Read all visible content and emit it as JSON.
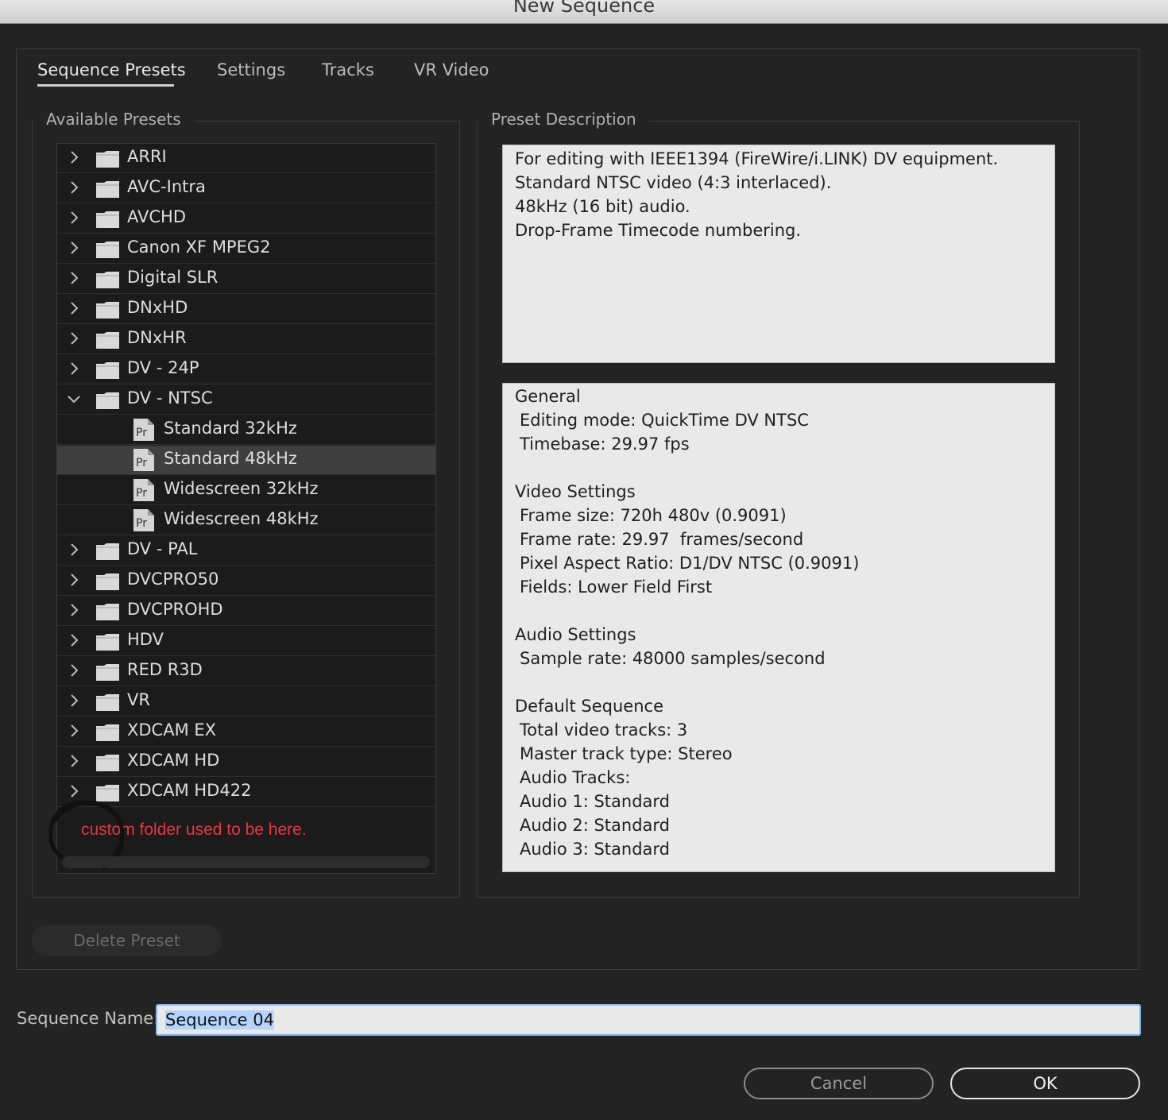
{
  "window": {
    "title": "New Sequence"
  },
  "tabs": [
    {
      "label": "Sequence Presets",
      "active": true
    },
    {
      "label": "Settings",
      "active": false
    },
    {
      "label": "Tracks",
      "active": false
    },
    {
      "label": "VR Video",
      "active": false
    }
  ],
  "presets": {
    "legend": "Available Presets",
    "items": [
      {
        "label": "ARRI",
        "type": "folder",
        "expanded": false
      },
      {
        "label": "AVC-Intra",
        "type": "folder",
        "expanded": false
      },
      {
        "label": "AVCHD",
        "type": "folder",
        "expanded": false
      },
      {
        "label": "Canon XF MPEG2",
        "type": "folder",
        "expanded": false
      },
      {
        "label": "Digital SLR",
        "type": "folder",
        "expanded": false
      },
      {
        "label": "DNxHD",
        "type": "folder",
        "expanded": false
      },
      {
        "label": "DNxHR",
        "type": "folder",
        "expanded": false
      },
      {
        "label": "DV - 24P",
        "type": "folder",
        "expanded": false
      },
      {
        "label": "DV - NTSC",
        "type": "folder",
        "expanded": true
      },
      {
        "label": "Standard 32kHz",
        "type": "preset",
        "selected": false
      },
      {
        "label": "Standard 48kHz",
        "type": "preset",
        "selected": true
      },
      {
        "label": "Widescreen 32kHz",
        "type": "preset",
        "selected": false
      },
      {
        "label": "Widescreen 48kHz",
        "type": "preset",
        "selected": false
      },
      {
        "label": "DV - PAL",
        "type": "folder",
        "expanded": false
      },
      {
        "label": "DVCPRO50",
        "type": "folder",
        "expanded": false
      },
      {
        "label": "DVCPROHD",
        "type": "folder",
        "expanded": false
      },
      {
        "label": "HDV",
        "type": "folder",
        "expanded": false
      },
      {
        "label": "RED R3D",
        "type": "folder",
        "expanded": false
      },
      {
        "label": "VR",
        "type": "folder",
        "expanded": false
      },
      {
        "label": "XDCAM EX",
        "type": "folder",
        "expanded": false
      },
      {
        "label": "XDCAM HD",
        "type": "folder",
        "expanded": false
      },
      {
        "label": "XDCAM HD422",
        "type": "folder",
        "expanded": false
      }
    ],
    "annotation": "custom folder used to be here.",
    "preset_icon_text": "Pr"
  },
  "description": {
    "legend": "Preset Description",
    "lines": [
      "For editing with IEEE1394 (FireWire/i.LINK) DV equipment.",
      "Standard NTSC video (4:3 interlaced).",
      "48kHz (16 bit) audio.",
      "Drop-Frame Timecode numbering."
    ],
    "details": [
      {
        "text": "General",
        "indent": false
      },
      {
        "text": "Editing mode: QuickTime DV NTSC",
        "indent": true
      },
      {
        "text": "Timebase: 29.97 fps",
        "indent": true
      },
      {
        "text": "",
        "indent": false
      },
      {
        "text": "Video Settings",
        "indent": false
      },
      {
        "text": "Frame size: 720h 480v (0.9091)",
        "indent": true
      },
      {
        "text": "Frame rate: 29.97  frames/second",
        "indent": true
      },
      {
        "text": "Pixel Aspect Ratio: D1/DV NTSC (0.9091)",
        "indent": true
      },
      {
        "text": "Fields: Lower Field First",
        "indent": true
      },
      {
        "text": "",
        "indent": false
      },
      {
        "text": "Audio Settings",
        "indent": false
      },
      {
        "text": "Sample rate: 48000 samples/second",
        "indent": true
      },
      {
        "text": "",
        "indent": false
      },
      {
        "text": "Default Sequence",
        "indent": false
      },
      {
        "text": "Total video tracks: 3",
        "indent": true
      },
      {
        "text": "Master track type: Stereo",
        "indent": true
      },
      {
        "text": "Audio Tracks:",
        "indent": true
      },
      {
        "text": "Audio 1: Standard",
        "indent": true
      },
      {
        "text": "Audio 2: Standard",
        "indent": true
      },
      {
        "text": "Audio 3: Standard",
        "indent": true
      }
    ]
  },
  "delete_button": {
    "label": "Delete Preset",
    "enabled": false
  },
  "sequence_name": {
    "label": "Sequence Name:",
    "value": "Sequence 04"
  },
  "buttons": {
    "cancel": "Cancel",
    "ok": "OK"
  },
  "colors": {
    "background": "#232323",
    "annotation": "#e5383b",
    "focus_ring": "#7eb6f1",
    "selection": "#3f3f3f"
  }
}
